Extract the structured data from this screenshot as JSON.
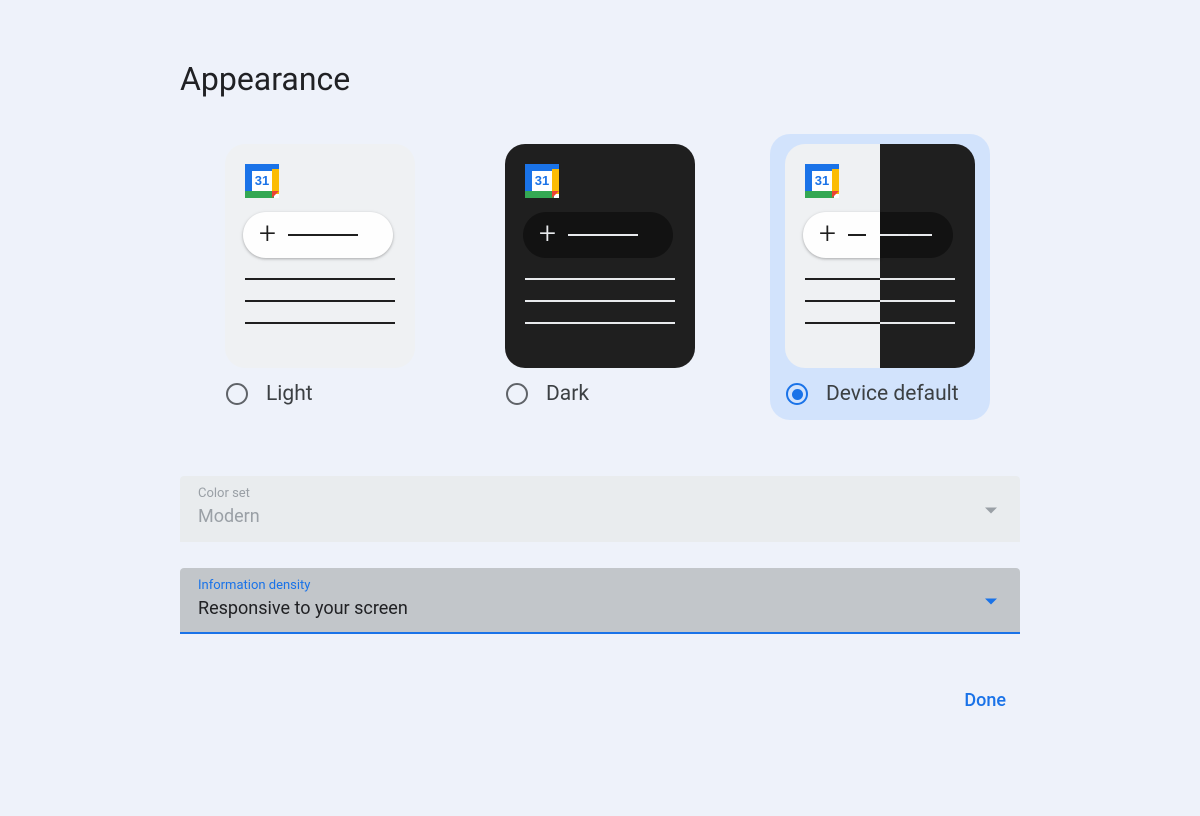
{
  "title": "Appearance",
  "themes": {
    "light": {
      "label": "Light",
      "selected": false
    },
    "dark": {
      "label": "Dark",
      "selected": false
    },
    "device": {
      "label": "Device default",
      "selected": true
    }
  },
  "calendar_icon": {
    "day_number": "31"
  },
  "color_set": {
    "label": "Color set",
    "value": "Modern"
  },
  "density": {
    "label": "Information density",
    "value": "Responsive to your screen"
  },
  "buttons": {
    "done": "Done"
  },
  "colors": {
    "accent": "#1a73e8",
    "selected_bg": "#d2e3fc"
  }
}
